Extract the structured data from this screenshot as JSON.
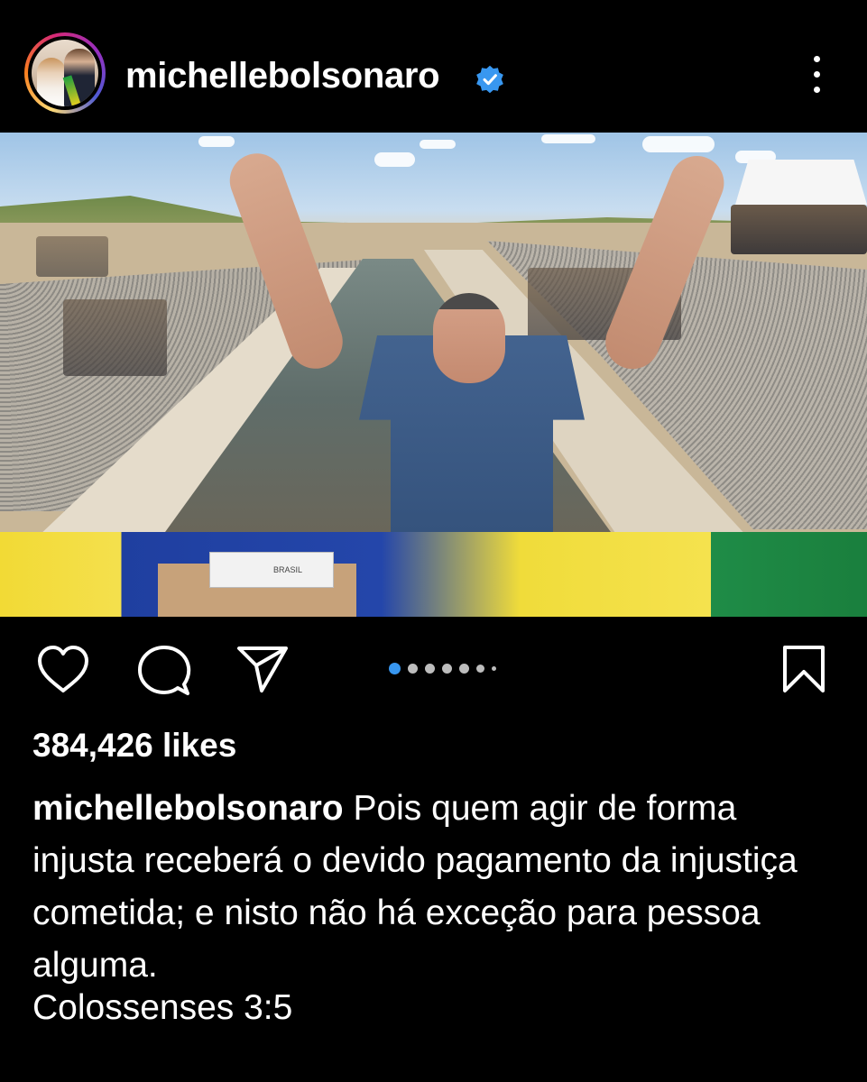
{
  "post": {
    "username": "michellebolsonaro",
    "verified": true,
    "likes_text": "384,426 likes",
    "caption_user": "michellebolsonaro",
    "caption_text": "Pois quem agir de forma injusta receberá o devido pagamento da injustiça cometida; e nisto não há exceção para pessoa alguma.",
    "caption_reference": "Colossenses 3:5",
    "carousel": {
      "total": 7,
      "active": 1
    }
  },
  "photo": {
    "plaque_text": "BRASIL"
  },
  "icons": {
    "like": "heart-icon",
    "comment": "comment-icon",
    "share": "send-icon",
    "save": "bookmark-icon",
    "more": "more-vertical-icon",
    "verified": "verified-badge-icon"
  },
  "colors": {
    "background": "#000000",
    "text": "#ffffff",
    "verified": "#3897f0",
    "carousel_active": "#3897f0",
    "carousel_inactive": "#bdbdbd"
  }
}
